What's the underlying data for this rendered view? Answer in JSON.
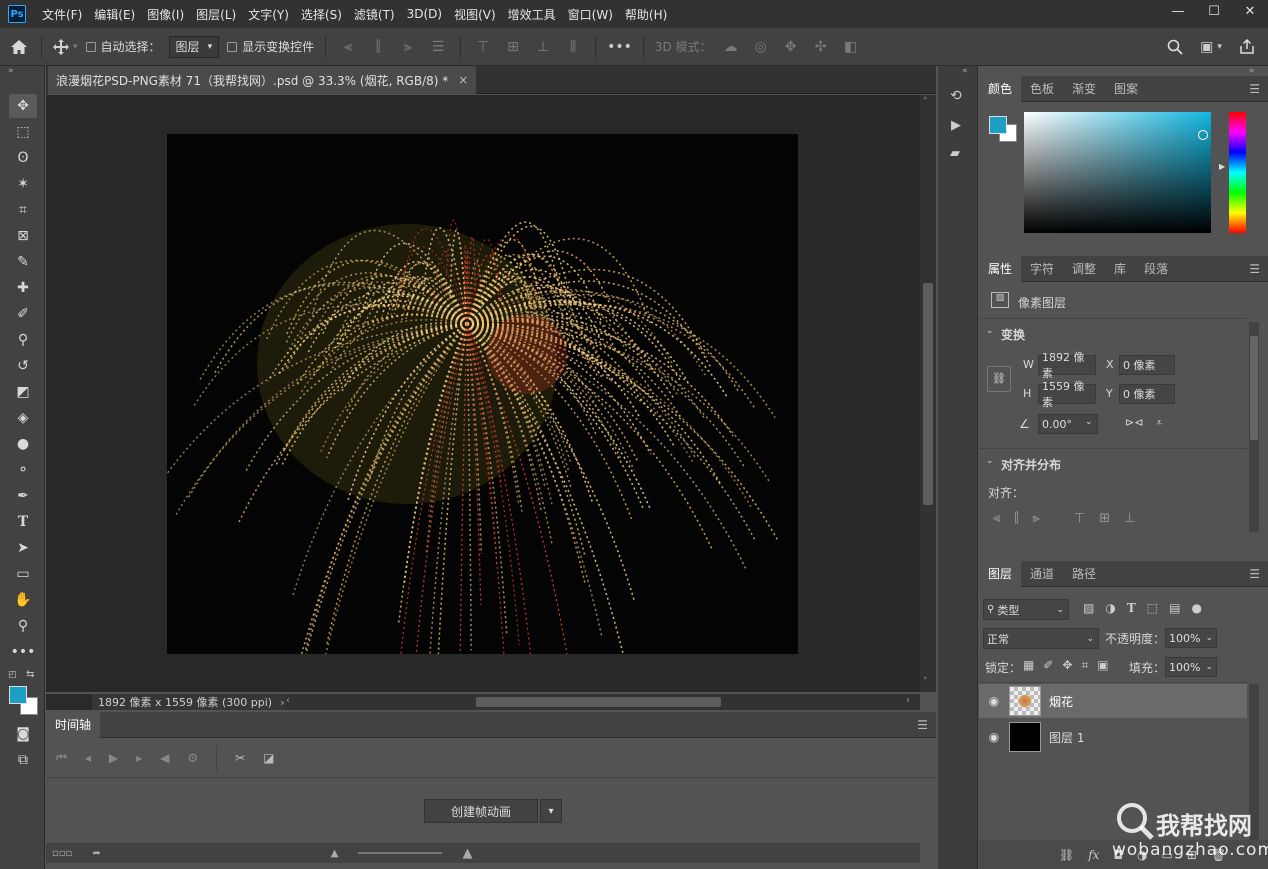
{
  "app": {
    "logo": "Ps"
  },
  "menu": [
    "文件(F)",
    "编辑(E)",
    "图像(I)",
    "图层(L)",
    "文字(Y)",
    "选择(S)",
    "滤镜(T)",
    "3D(D)",
    "视图(V)",
    "增效工具",
    "窗口(W)",
    "帮助(H)"
  ],
  "window_controls": {
    "minimize": "—",
    "maximize": "☐",
    "close": "✕"
  },
  "options": {
    "auto_select_label": "自动选择：",
    "auto_select_value": "图层",
    "show_transform_label": "显示变换控件",
    "mode_3d_label": "3D 模式："
  },
  "document": {
    "tab_title": "浪漫烟花PSD-PNG素材 71（我帮找网）.psd @ 33.3% (烟花, RGB/8) *",
    "tab_close": "×",
    "status": "1892 像素 x 1559 像素 (300 ppi)"
  },
  "colors": {
    "foreground": "#1ba0c4",
    "background": "#ffffff",
    "accent": "#31a8ff"
  },
  "timeline": {
    "tab": "时间轴",
    "create_button": "创建帧动画"
  },
  "color_panel": {
    "tabs": [
      "颜色",
      "色板",
      "渐变",
      "图案"
    ],
    "selected": 0
  },
  "properties": {
    "tabs": [
      "属性",
      "字符",
      "调整",
      "库",
      "段落"
    ],
    "selected": 0,
    "layer_type": "像素图层",
    "transform_title": "变换",
    "w_label": "W",
    "w_value": "1892 像素",
    "x_label": "X",
    "x_value": "0 像素",
    "h_label": "H",
    "h_value": "1559 像素",
    "y_label": "Y",
    "y_value": "0 像素",
    "angle_value": "0.00°",
    "align_title": "对齐并分布",
    "align_label": "对齐："
  },
  "layers": {
    "tabs": [
      "图层",
      "通道",
      "路径"
    ],
    "selected": 0,
    "filter_label": "类型",
    "blend_mode": "正常",
    "opacity_label": "不透明度：",
    "opacity_value": "100%",
    "lock_label": "锁定：",
    "fill_label": "填充：",
    "fill_value": "100%",
    "items": [
      {
        "name": "烟花",
        "selected": true
      },
      {
        "name": "图层 1",
        "selected": false
      }
    ],
    "footer_fx": "fx"
  },
  "watermark": {
    "text": "我帮找网",
    "url": "wobangzhao.com"
  }
}
